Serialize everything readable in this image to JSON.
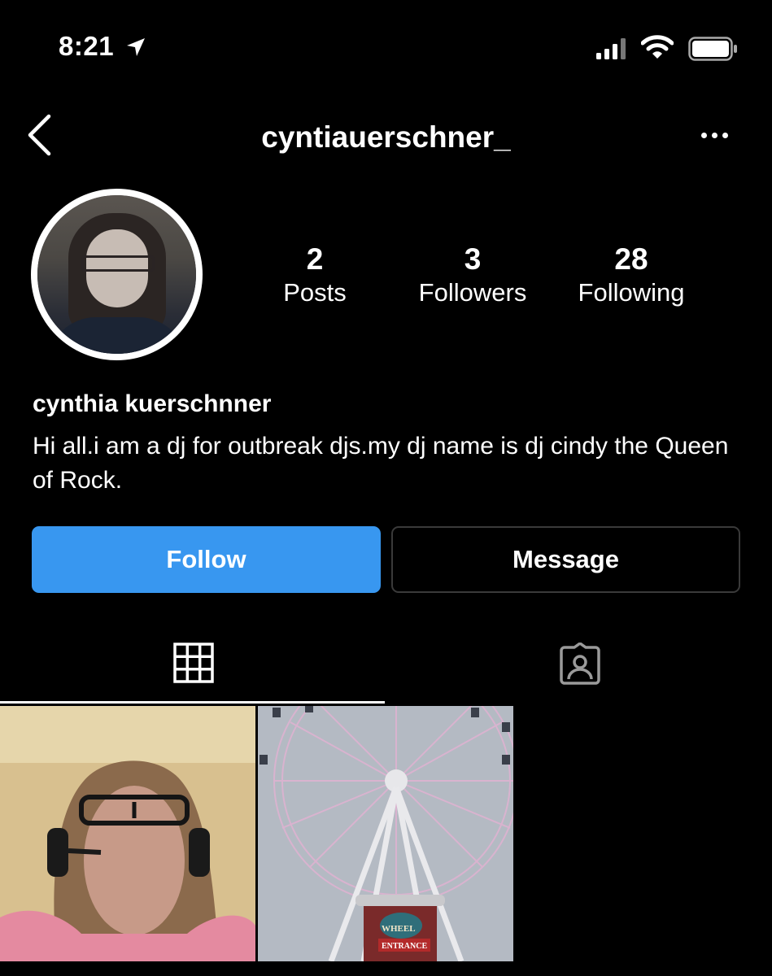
{
  "status_bar": {
    "time": "8:21"
  },
  "header": {
    "username": "cyntiauerschner_"
  },
  "profile": {
    "stats": {
      "posts": {
        "value": "2",
        "label": "Posts"
      },
      "followers": {
        "value": "3",
        "label": "Followers"
      },
      "following": {
        "value": "28",
        "label": "Following"
      }
    },
    "full_name": "cynthia kuerschnner",
    "bio": "Hi all.i am a dj for outbreak djs.my dj name is dj cindy the Queen of Rock."
  },
  "actions": {
    "follow_label": "Follow",
    "message_label": "Message"
  },
  "tabs": [
    {
      "icon": "grid-icon",
      "active": true
    },
    {
      "icon": "tagged-icon",
      "active": false
    }
  ],
  "posts": [
    {
      "description_icon": "photo-thumbnail"
    },
    {
      "description_icon": "photo-thumbnail",
      "sign_text": "WHEEL",
      "entrance_text": "ENTRANCE"
    }
  ],
  "colors": {
    "follow_button": "#3897f0",
    "background": "#000000",
    "text": "#ffffff"
  }
}
